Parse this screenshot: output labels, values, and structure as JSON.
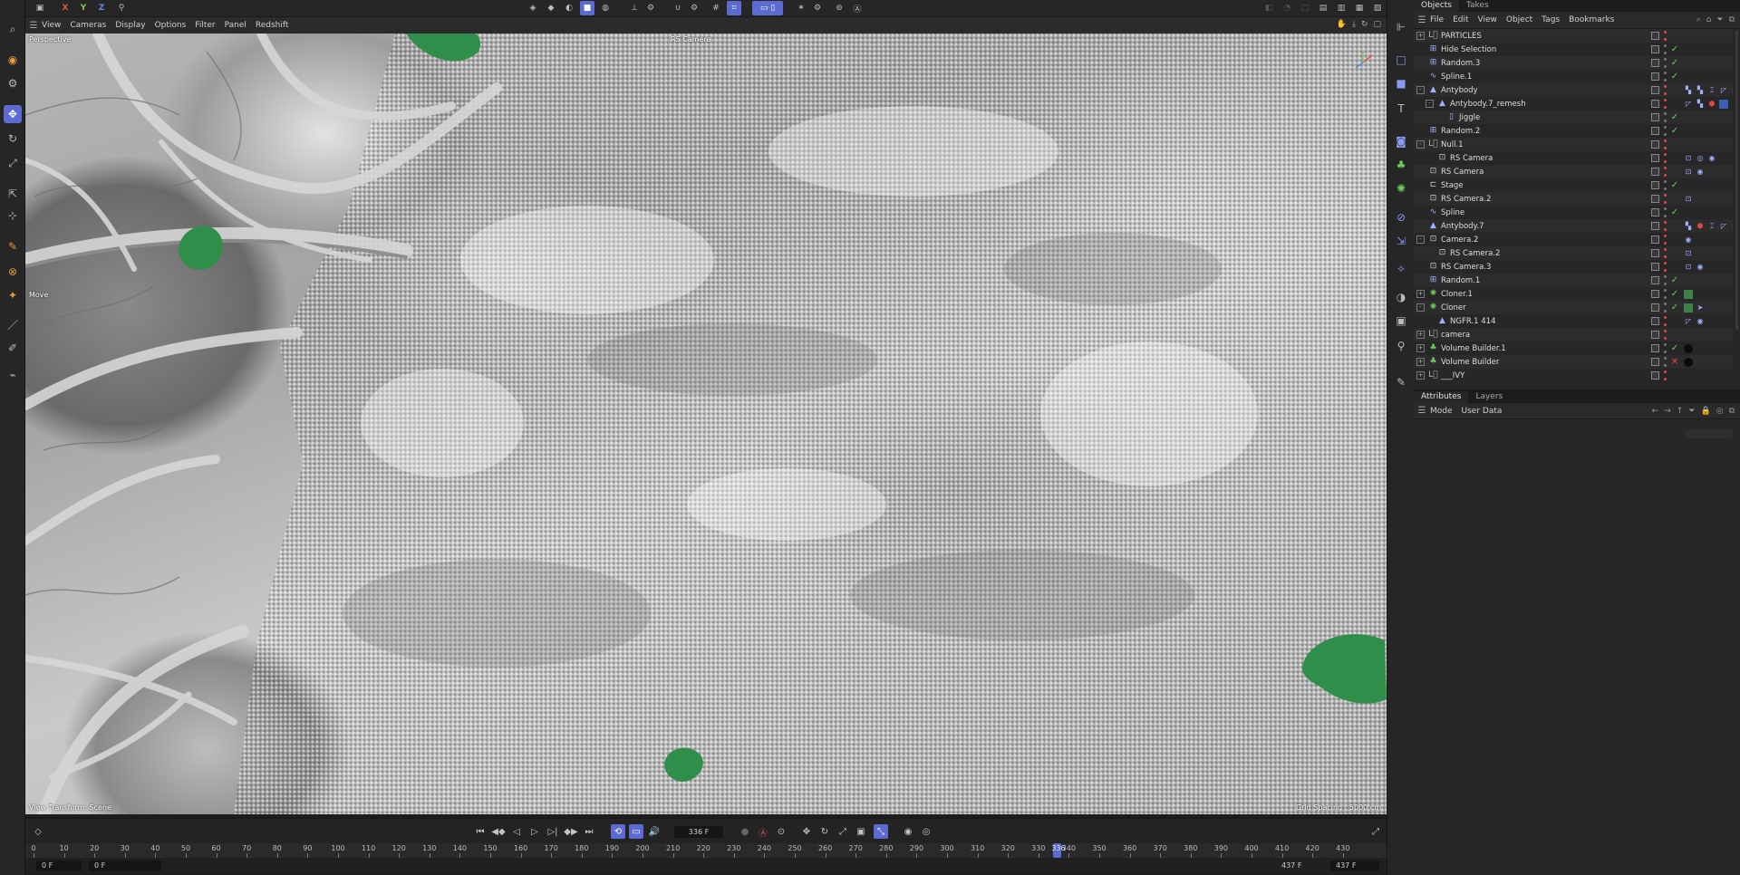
{
  "top_toolbar": {
    "axis_x": "X",
    "axis_y": "Y",
    "axis_z": "Z"
  },
  "viewport_menu": [
    "View",
    "Cameras",
    "Display",
    "Options",
    "Filter",
    "Panel",
    "Redshift"
  ],
  "viewport": {
    "view_name": "Perspective",
    "camera_name": "RS Camera",
    "tool_hint": "Move",
    "view_transform": "View Transform: Scene",
    "grid_spacing": "Grid Spacing : 5000 cm"
  },
  "timeline": {
    "current_frame": "336 F",
    "playhead_label": "336",
    "ticks": [
      "0",
      "10",
      "20",
      "30",
      "40",
      "50",
      "60",
      "70",
      "80",
      "90",
      "100",
      "110",
      "120",
      "130",
      "140",
      "150",
      "160",
      "170",
      "180",
      "190",
      "200",
      "210",
      "220",
      "230",
      "240",
      "250",
      "260",
      "270",
      "280",
      "290",
      "300",
      "310",
      "320",
      "330",
      "340",
      "350",
      "360",
      "370",
      "380",
      "390",
      "400",
      "410",
      "420",
      "430"
    ],
    "range_start": "0 F",
    "preview_start": "0 F",
    "preview_end": "437 F",
    "range_end": "437 F"
  },
  "objects_panel": {
    "tabs": [
      "Objects",
      "Takes"
    ],
    "menu": [
      "File",
      "Edit",
      "View",
      "Object",
      "Tags",
      "Bookmarks"
    ],
    "rows": [
      {
        "name": "PARTICLES",
        "indent": 0,
        "expander": "+",
        "icon": "null",
        "state": "none",
        "tags": []
      },
      {
        "name": "Hide Selection",
        "indent": 0,
        "expander": "",
        "icon": "grid",
        "state": "check",
        "tags": []
      },
      {
        "name": "Random.3",
        "indent": 0,
        "expander": "",
        "icon": "grid",
        "state": "check",
        "tags": []
      },
      {
        "name": "Spline.1",
        "indent": 0,
        "expander": "",
        "icon": "spline",
        "state": "check",
        "tags": []
      },
      {
        "name": "Antybody",
        "indent": 0,
        "expander": "-",
        "icon": "poly",
        "state": "none",
        "tags": [
          "vertex",
          "vertex",
          "pin",
          "phong",
          "phong"
        ]
      },
      {
        "name": "Antybody.7_remesh",
        "indent": 1,
        "expander": "-",
        "icon": "poly",
        "state": "none",
        "tags": [
          "phong",
          "vertex",
          "red",
          "blue"
        ]
      },
      {
        "name": "Jiggle",
        "indent": 2,
        "expander": "",
        "icon": "deformer",
        "state": "check",
        "tags": []
      },
      {
        "name": "Random.2",
        "indent": 0,
        "expander": "",
        "icon": "grid",
        "state": "check",
        "tags": []
      },
      {
        "name": "Null.1",
        "indent": 0,
        "expander": "-",
        "icon": "null",
        "state": "none",
        "tags": []
      },
      {
        "name": "RS Camera",
        "indent": 1,
        "expander": "",
        "icon": "camera",
        "state": "none",
        "tags": [
          "target",
          "circle",
          "eye"
        ]
      },
      {
        "name": "RS Camera",
        "indent": 0,
        "expander": "",
        "icon": "camera",
        "state": "none",
        "tags": [
          "target",
          "eye"
        ]
      },
      {
        "name": "Stage",
        "indent": 0,
        "expander": "",
        "icon": "stage",
        "state": "check",
        "tags": []
      },
      {
        "name": "RS Camera.2",
        "indent": 0,
        "expander": "",
        "icon": "camera",
        "state": "none",
        "tags": [
          "target"
        ]
      },
      {
        "name": "Spline",
        "indent": 0,
        "expander": "",
        "icon": "spline",
        "state": "check",
        "tags": []
      },
      {
        "name": "Antybody.7",
        "indent": 0,
        "expander": "",
        "icon": "poly",
        "state": "none",
        "tags": [
          "vertex",
          "red",
          "pin",
          "phong",
          "phong",
          "blue"
        ]
      },
      {
        "name": "Camera.2",
        "indent": 0,
        "expander": "-",
        "icon": "camera",
        "state": "none",
        "tags": [
          "eye"
        ]
      },
      {
        "name": "RS Camera.2",
        "indent": 1,
        "expander": "",
        "icon": "camera",
        "state": "none",
        "tags": [
          "target"
        ]
      },
      {
        "name": "RS Camera.3",
        "indent": 0,
        "expander": "",
        "icon": "camera",
        "state": "none",
        "tags": [
          "target",
          "eye"
        ]
      },
      {
        "name": "Random.1",
        "indent": 0,
        "expander": "",
        "icon": "grid",
        "state": "check",
        "tags": []
      },
      {
        "name": "Cloner.1",
        "indent": 0,
        "expander": "+",
        "icon": "cloner",
        "state": "check",
        "tags": [
          "green"
        ]
      },
      {
        "name": "Cloner",
        "indent": 0,
        "expander": "-",
        "icon": "cloner",
        "state": "check",
        "tags": [
          "green",
          "cursor"
        ]
      },
      {
        "name": "NGFR.1 414",
        "indent": 1,
        "expander": "",
        "icon": "poly",
        "state": "none",
        "tags": [
          "phong",
          "eye"
        ]
      },
      {
        "name": "camera",
        "indent": 0,
        "expander": "+",
        "icon": "null",
        "state": "none",
        "tags": []
      },
      {
        "name": "Volume Builder.1",
        "indent": 0,
        "expander": "+",
        "icon": "volume",
        "state": "check",
        "tags": [
          "black"
        ]
      },
      {
        "name": "Volume Builder",
        "indent": 0,
        "expander": "+",
        "icon": "volume",
        "state": "cross",
        "tags": [
          "black"
        ]
      },
      {
        "name": "___IVY",
        "indent": 0,
        "expander": "+",
        "icon": "null",
        "state": "none",
        "tags": []
      }
    ]
  },
  "attributes_panel": {
    "tabs": [
      "Attributes",
      "Layers"
    ],
    "menu": [
      "Mode",
      "User Data"
    ]
  },
  "colors": {
    "accent": "#5b6bd1",
    "check": "#62d35a",
    "cross": "#e04848",
    "green_blob": "#2f8f4a"
  }
}
